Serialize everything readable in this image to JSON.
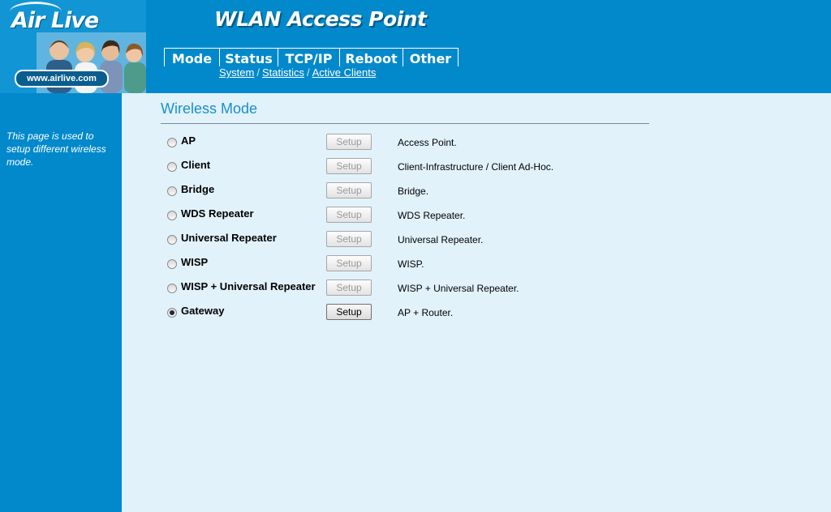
{
  "app": {
    "logo_text": "Air Live",
    "logo_url": "www.airlive.com",
    "title": "WLAN Access Point"
  },
  "tabs": [
    {
      "label": "Mode"
    },
    {
      "label": "Status"
    },
    {
      "label": "TCP/IP"
    },
    {
      "label": "Reboot"
    },
    {
      "label": "Other"
    }
  ],
  "subnav": [
    "System",
    "Statistics",
    "Active Clients"
  ],
  "sidebar": {
    "help_text": "This page is used to setup different wireless mode."
  },
  "main": {
    "title": "Wireless Mode",
    "setup_label": "Setup",
    "modes": [
      {
        "name": "AP",
        "description": "Access Point.",
        "selected": false,
        "setup_enabled": false
      },
      {
        "name": "Client",
        "description": "Client-Infrastructure / Client Ad-Hoc.",
        "selected": false,
        "setup_enabled": false
      },
      {
        "name": "Bridge",
        "description": "Bridge.",
        "selected": false,
        "setup_enabled": false
      },
      {
        "name": "WDS Repeater",
        "description": "WDS Repeater.",
        "selected": false,
        "setup_enabled": false
      },
      {
        "name": "Universal Repeater",
        "description": "Universal Repeater.",
        "selected": false,
        "setup_enabled": false
      },
      {
        "name": "WISP",
        "description": "WISP.",
        "selected": false,
        "setup_enabled": false
      },
      {
        "name": "WISP + Universal Repeater",
        "description": "WISP + Universal Repeater.",
        "selected": false,
        "setup_enabled": false
      },
      {
        "name": "Gateway",
        "description": "AP + Router.",
        "selected": true,
        "setup_enabled": true
      }
    ]
  },
  "colors": {
    "header_blue": "#0289cc",
    "content_bg": "#e1f2fb",
    "title_blue": "#1a8fcd"
  }
}
